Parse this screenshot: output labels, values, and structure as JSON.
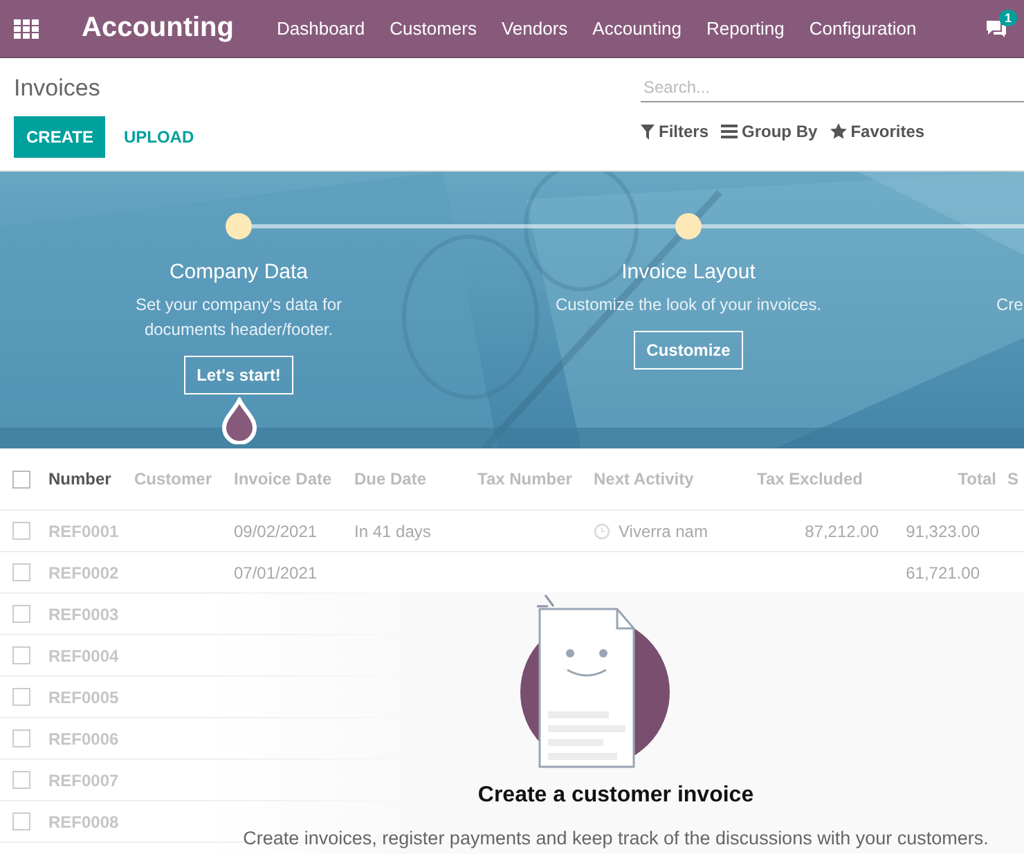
{
  "navbar": {
    "app_name": "Accounting",
    "menu": [
      "Dashboard",
      "Customers",
      "Vendors",
      "Accounting",
      "Reporting",
      "Configuration"
    ],
    "messages_badge": "1"
  },
  "control_panel": {
    "title": "Invoices",
    "search": {
      "placeholder": "Search..."
    },
    "buttons": [
      "CREATE",
      "UPLOAD"
    ],
    "search_options": [
      {
        "kind": "filter",
        "label": "Filters"
      },
      {
        "kind": "group",
        "label": "Group By"
      },
      {
        "kind": "favorite",
        "label": "Favorites"
      }
    ]
  },
  "onboarding": {
    "kind": "picture",
    "steps": [
      {
        "title": "Company Data",
        "description": "Set your company's data for documents header/footer.",
        "button": "Let's start!",
        "current": true
      },
      {
        "title": "Invoice Layout",
        "description": "Customize the look of your invoices.",
        "button": "Customize",
        "current": false
      },
      {
        "description": "Cre",
        "current": false
      }
    ]
  },
  "table": {
    "all_checked": false,
    "columns": [
      "Number",
      "Customer",
      "Invoice Date",
      "Due Date",
      "Tax Number",
      "Next Activity",
      "Tax Excluded",
      "Total",
      "S"
    ],
    "rows": [
      {
        "checked": false,
        "number": "REF0001",
        "invoice_date": "09/02/2021",
        "due_date": "In 41 days",
        "next_activity": "Viverra nam",
        "tax_excluded": "87,212.00",
        "total": "91,323.00"
      },
      {
        "checked": false,
        "number": "REF0002",
        "invoice_date": "07/01/2021",
        "total": "61,721.00"
      },
      {
        "checked": false,
        "number": "REF0003"
      },
      {
        "checked": false,
        "number": "REF0004"
      },
      {
        "checked": false,
        "number": "REF0005"
      },
      {
        "checked": false,
        "number": "REF0006"
      },
      {
        "checked": false,
        "number": "REF0007"
      },
      {
        "checked": false,
        "number": "REF0008"
      }
    ]
  },
  "empty_state": {
    "title": "Create a customer invoice",
    "text": "Create invoices, register payments and keep track of the discussions with your customers."
  }
}
